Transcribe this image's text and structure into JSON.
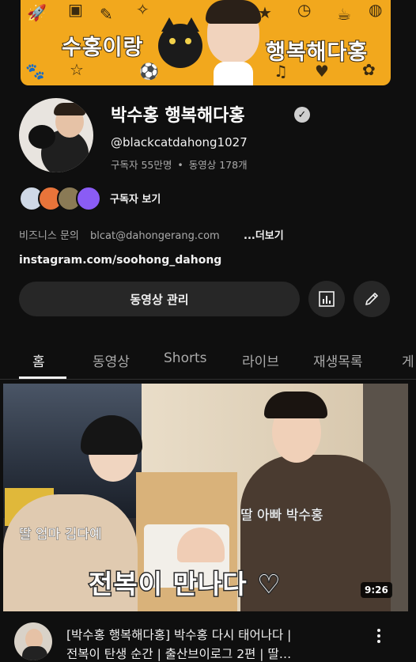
{
  "banner": {
    "text_left": "수홍이랑",
    "text_right": "행복해다홍"
  },
  "channel": {
    "name": "박수홍 행복해다홍",
    "handle": "@blackcatdahong1027",
    "subscribers": "구독자 55만명",
    "separator": "•",
    "videos": "동영상 178개",
    "subscribers_link": "구독자 보기",
    "business_label": "비즈니스 문의",
    "business_email": "blcat@dahongerang.com",
    "more": "...더보기",
    "instagram": "instagram.com/soohong_dahong",
    "verified_mark": "✓"
  },
  "buttons": {
    "manage": "동영상 관리",
    "analytics_icon": "analytics-icon",
    "edit_icon": "pencil-icon"
  },
  "tabs": [
    {
      "label": "홈",
      "active": true
    },
    {
      "label": "동영상",
      "active": false
    },
    {
      "label": "Shorts",
      "active": false
    },
    {
      "label": "라이브",
      "active": false
    },
    {
      "label": "재생목록",
      "active": false
    },
    {
      "label": "게",
      "active": false
    }
  ],
  "video": {
    "thumb_title": "전복이 만나다 ♡",
    "label_mom": "딸 엄마 김다예",
    "label_dad": "딸 아빠 박수홍",
    "duration": "9:26",
    "title_line1": "[박수홍 행복해다홍] 박수홍 다시 태어나다 |",
    "title_line2": "전복이 탄생 순간 | 출산브이로그 2편 | 딸…"
  },
  "colors": {
    "background": "#0f0f0f",
    "banner": "#f2a81d",
    "button_bg": "#272727",
    "secondary_text": "#aaaaaa"
  }
}
